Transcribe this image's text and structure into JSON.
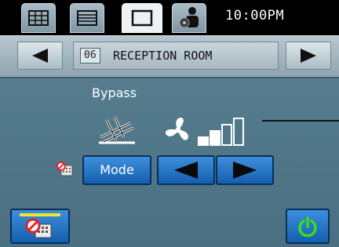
{
  "status_bar": {
    "tabs": [
      {
        "name": "grid-view-icon",
        "active": false
      },
      {
        "name": "list-view-icon",
        "active": false
      },
      {
        "name": "single-view-icon",
        "active": true
      },
      {
        "name": "user-settings-icon",
        "active": false
      }
    ],
    "clock": "10:00PM"
  },
  "room_nav": {
    "prev_icon": "left-arrow-icon",
    "next_icon": "right-arrow-icon",
    "room_number": "06",
    "room_name": "RECEPTION ROOM"
  },
  "ventilation": {
    "mode_label": "Bypass",
    "mode_icon": "bypass-damper-icon",
    "fan_icon": "fan-icon",
    "fan_speed_level": 2,
    "fan_speed_max": 4
  },
  "controls": {
    "mode_button_label": "Mode",
    "decrease_icon": "left-arrow-icon",
    "increase_icon": "right-arrow-icon",
    "prohibited_icon": "prohibited-remote-icon",
    "power_icon": "power-icon"
  },
  "colors": {
    "background": "#51788a",
    "button_blue": "#2a76c6",
    "power_green": "#3bdc1f",
    "prohibit_red": "#e0242c"
  }
}
